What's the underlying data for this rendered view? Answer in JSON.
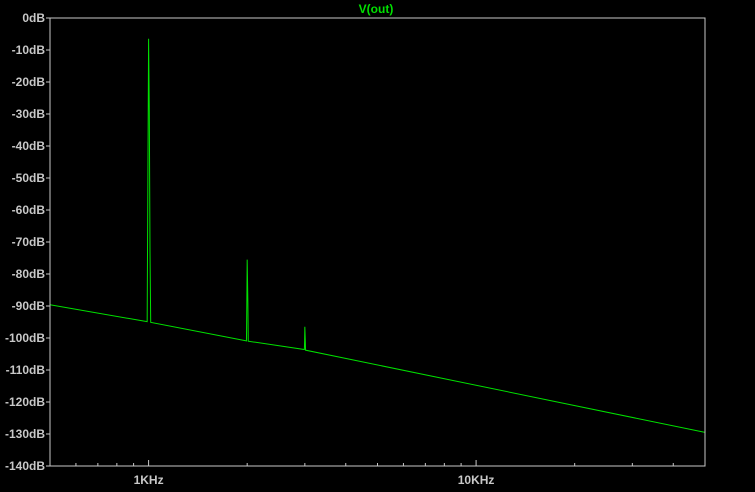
{
  "chart_data": {
    "type": "line",
    "title": "V(out)",
    "x_scale": "log",
    "xlim": [
      500,
      50000
    ],
    "ylim": [
      -140,
      0
    ],
    "grid": false,
    "y_ticks": [
      0,
      -10,
      -20,
      -30,
      -40,
      -50,
      -60,
      -70,
      -80,
      -90,
      -100,
      -110,
      -120,
      -130,
      -140
    ],
    "y_tick_labels": [
      "0dB",
      "-10dB",
      "-20dB",
      "-30dB",
      "-40dB",
      "-50dB",
      "-60dB",
      "-70dB",
      "-80dB",
      "-90dB",
      "-100dB",
      "-110dB",
      "-120dB",
      "-130dB",
      "-140dB"
    ],
    "x_major_ticks": [
      1000,
      10000
    ],
    "x_tick_labels": [
      "1KHz",
      "10KHz"
    ],
    "x_minor_ticks": [
      600,
      700,
      800,
      900,
      2000,
      3000,
      4000,
      5000,
      6000,
      7000,
      8000,
      9000,
      20000,
      30000,
      40000
    ],
    "colors": {
      "background": "#000000",
      "frame": "#c8c8c8",
      "text": "#c8c8c8",
      "trace": "#00e000",
      "title": "#00e000"
    },
    "series": [
      {
        "name": "V(out)",
        "points": [
          [
            500,
            -89.6
          ],
          [
            990,
            -94.9
          ],
          [
            995,
            -51
          ],
          [
            1000,
            -6.5
          ],
          [
            1005,
            -29
          ],
          [
            1010,
            -73
          ],
          [
            1015,
            -95.1
          ],
          [
            1990,
            -100.9
          ],
          [
            1995,
            -89
          ],
          [
            2000,
            -75.5
          ],
          [
            2010,
            -89
          ],
          [
            2015,
            -101.0
          ],
          [
            2990,
            -103.6
          ],
          [
            2995,
            -101
          ],
          [
            3000,
            -96.5
          ],
          [
            3010,
            -101
          ],
          [
            3015,
            -103.8
          ],
          [
            50000,
            -129.5
          ]
        ]
      }
    ]
  }
}
